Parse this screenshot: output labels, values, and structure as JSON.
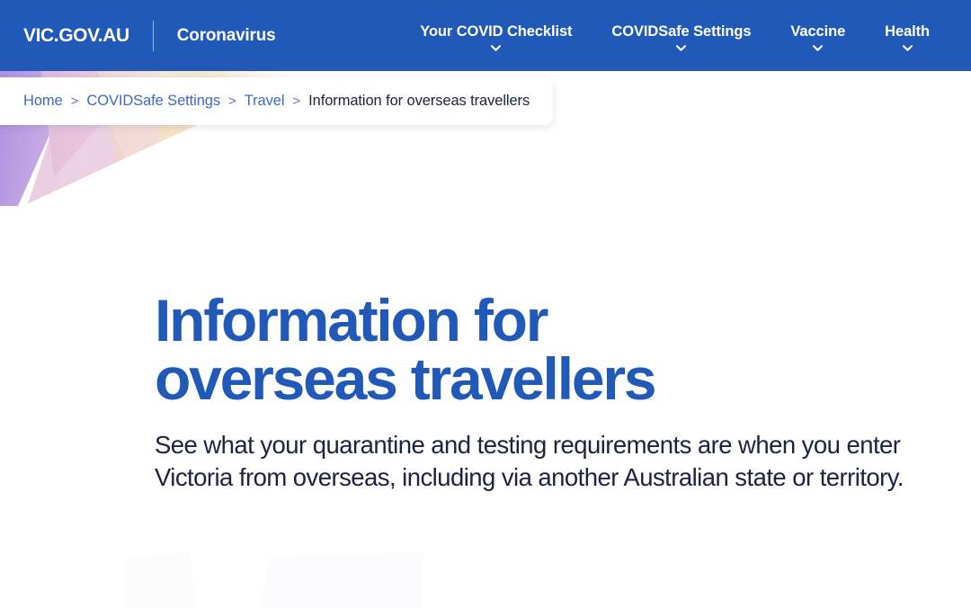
{
  "header": {
    "logo": "VIC.GOV.AU",
    "section": "Coronavirus",
    "nav_items": [
      {
        "label": "Your COVID Checklist",
        "has_dropdown": true,
        "icon": "chevron-down-icon"
      },
      {
        "label": "COVIDSafe Settings",
        "has_dropdown": true,
        "icon": "chevron-down-icon"
      },
      {
        "label": "Vaccine",
        "has_dropdown": true,
        "icon": "chevron-down-icon"
      },
      {
        "label": "Health",
        "has_dropdown": true,
        "icon": "chevron-down-icon"
      }
    ],
    "background_color": "#2159b8",
    "text_color": "#ffffff"
  },
  "breadcrumb": {
    "separator": ">",
    "items": [
      {
        "label": "Home",
        "is_link": true
      },
      {
        "label": "COVIDSafe Settings",
        "is_link": true
      },
      {
        "label": "Travel",
        "is_link": true
      },
      {
        "label": "Information for overseas travellers",
        "is_link": false
      }
    ],
    "link_color": "#3f68c8",
    "current_color": "#1c2340"
  },
  "hero": {
    "title": "Information for overseas travellers",
    "subtitle": "See what your quarantine and testing requirements are when you enter Victoria from overseas, including via another Australian state or territory.",
    "title_color": "#2159b8",
    "subtitle_color": "#1c2340"
  },
  "decor": {
    "name": "polygon-gradient-graphic",
    "colors": [
      "#b79ae2",
      "#d9aee0",
      "#edcad6",
      "#f6e3d0",
      "#f3dcb4",
      "#faf1e2"
    ]
  }
}
